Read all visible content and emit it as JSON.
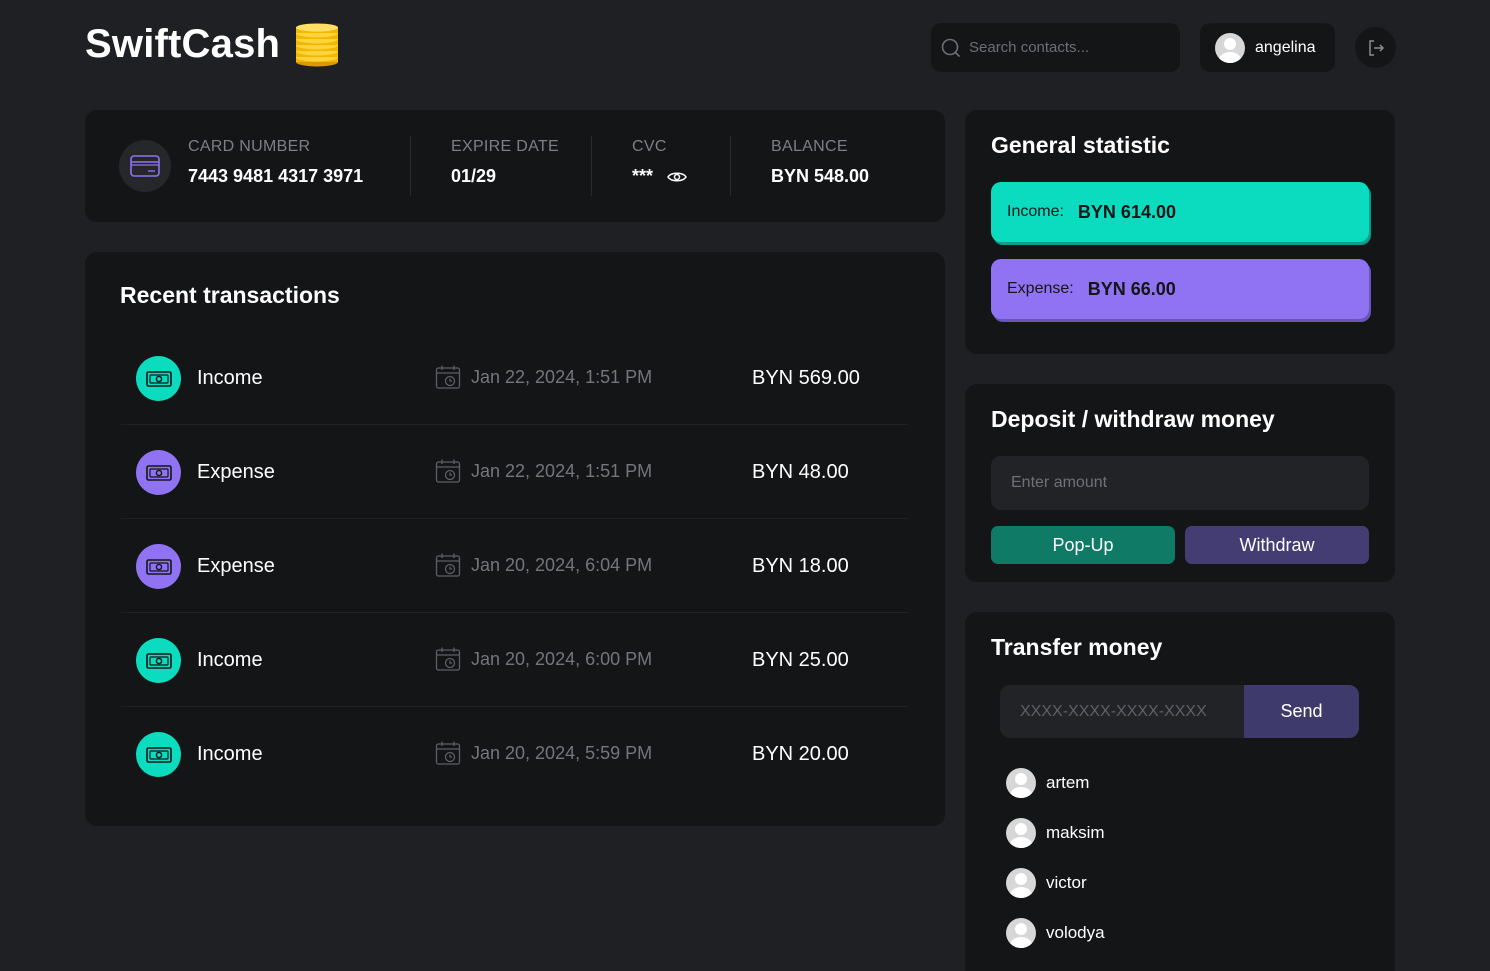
{
  "app": {
    "title": "SwiftCash",
    "logo_icon": "coins-stack-icon"
  },
  "header": {
    "search_placeholder": "Search contacts...",
    "username": "angelina",
    "logout_icon": "logout-icon"
  },
  "card": {
    "number_label": "CARD NUMBER",
    "number": "7443 9481 4317 3971",
    "expire_label": "EXPIRE DATE",
    "expire": "01/29",
    "cvc_label": "CVC",
    "cvc": "***",
    "balance_label": "BALANCE",
    "balance": "BYN 548.00"
  },
  "transactions": {
    "title": "Recent transactions",
    "items": [
      {
        "type": "Income",
        "date": "Jan 22, 2024, 1:51 PM",
        "amount": "BYN 569.00"
      },
      {
        "type": "Expense",
        "date": "Jan 22, 2024, 1:51 PM",
        "amount": "BYN 48.00"
      },
      {
        "type": "Expense",
        "date": "Jan 20, 2024, 6:04 PM",
        "amount": "BYN 18.00"
      },
      {
        "type": "Income",
        "date": "Jan 20, 2024, 6:00 PM",
        "amount": "BYN 25.00"
      },
      {
        "type": "Income",
        "date": "Jan 20, 2024, 5:59 PM",
        "amount": "BYN 20.00"
      }
    ]
  },
  "statistic": {
    "title": "General statistic",
    "income_label": "Income:",
    "income": "BYN 614.00",
    "expense_label": "Expense:",
    "expense": "BYN 66.00"
  },
  "deposit": {
    "title": "Deposit / withdraw money",
    "amount_placeholder": "Enter amount",
    "popup_label": "Pop-Up",
    "withdraw_label": "Withdraw"
  },
  "transfer": {
    "title": "Transfer money",
    "card_placeholder": "XXXX-XXXX-XXXX-XXXX",
    "send_label": "Send",
    "contacts": [
      "artem",
      "maksim",
      "victor",
      "volodya"
    ]
  },
  "colors": {
    "background": "#1f2023",
    "panel": "#141517",
    "income": "#0bdcbf",
    "expense": "#8f73f2",
    "popup_button": "#0f7a66",
    "withdraw_button": "#443d73",
    "send_button": "#3f3a6c"
  }
}
